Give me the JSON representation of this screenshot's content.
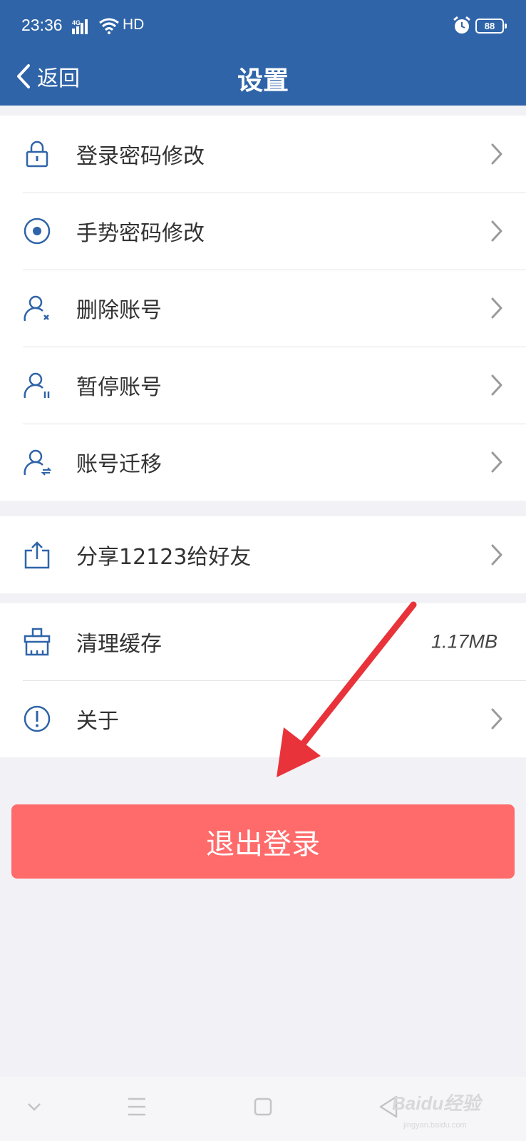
{
  "status_bar": {
    "time": "23:36",
    "network": "4G",
    "hd": "HD",
    "battery": "88"
  },
  "nav": {
    "back_label": "返回",
    "title": "设置"
  },
  "groups": [
    {
      "items": [
        {
          "label": "登录密码修改",
          "icon": "lock-icon"
        },
        {
          "label": "手势密码修改",
          "icon": "gesture-icon"
        },
        {
          "label": "删除账号",
          "icon": "user-delete-icon"
        },
        {
          "label": "暂停账号",
          "icon": "user-pause-icon"
        },
        {
          "label": "账号迁移",
          "icon": "user-transfer-icon"
        }
      ]
    },
    {
      "items": [
        {
          "label": "分享12123给好友",
          "icon": "share-icon"
        }
      ]
    },
    {
      "items": [
        {
          "label": "清理缓存",
          "icon": "broom-icon",
          "value": "1.17MB"
        },
        {
          "label": "关于",
          "icon": "info-icon"
        }
      ]
    }
  ],
  "logout_label": "退出登录",
  "watermark": {
    "text": "Baidu经验",
    "sub": "jingyan.baidu.com"
  },
  "colors": {
    "header": "#2f64a8",
    "icon": "#2f64a8",
    "logout": "#ff6b6b",
    "annotation_arrow": "#e8333a",
    "background": "#f2f2f6"
  }
}
